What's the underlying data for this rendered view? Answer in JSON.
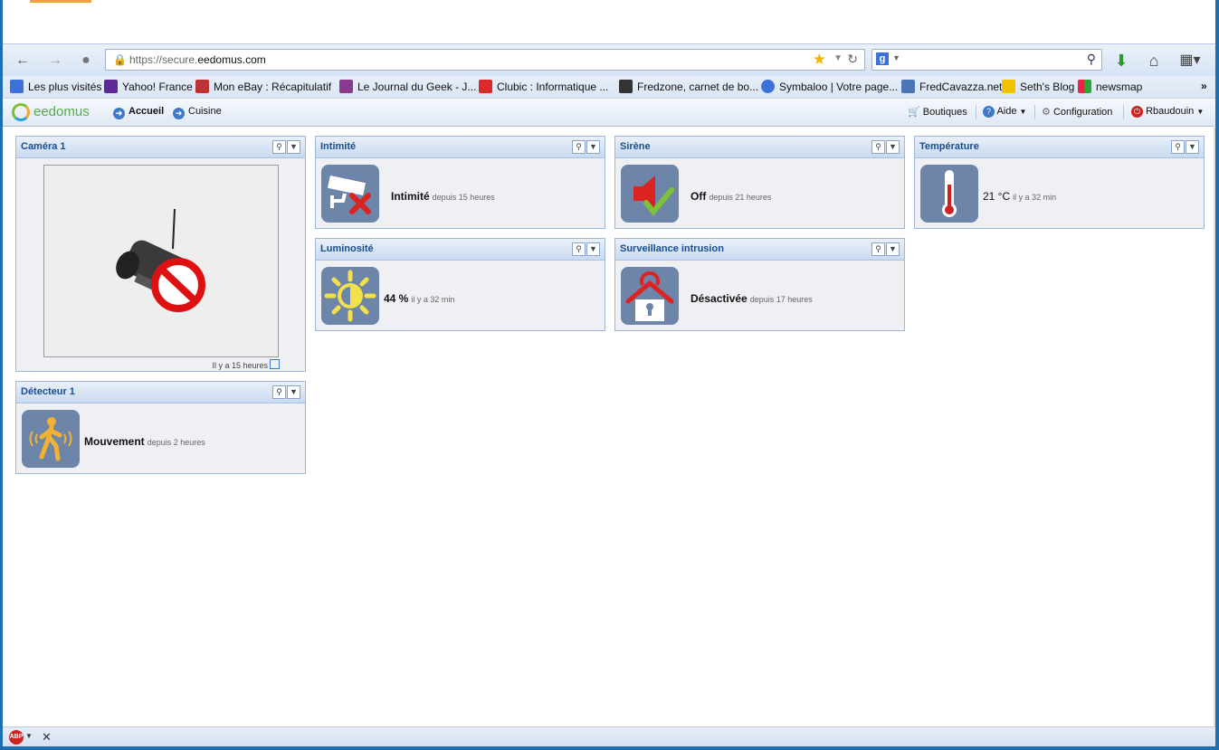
{
  "browser": {
    "url_prefix": "https://secure.",
    "url_domain": "eedomus.com",
    "bookmarks": [
      {
        "label": "Les plus visités",
        "icon": "globe-icon",
        "color": "#3b72d9"
      },
      {
        "label": "Yahoo! France",
        "icon": "yahoo-icon",
        "color": "#5f2a96"
      },
      {
        "label": "Mon eBay : Récapitulatif",
        "icon": "ebay-icon",
        "color": "#b33"
      },
      {
        "label": "Le Journal du Geek - J...",
        "icon": "geek-icon",
        "color": "#8a3a8e"
      },
      {
        "label": "Clubic : Informatique ...",
        "icon": "clubic-icon",
        "color": "#d92b2b"
      },
      {
        "label": "Fredzone, carnet de bo...",
        "icon": "fredzone-icon",
        "color": "#333"
      },
      {
        "label": "Symbaloo | Votre page...",
        "icon": "symbaloo-icon",
        "color": "#3b72d9"
      },
      {
        "label": "FredCavazza.net",
        "icon": "monitor-icon",
        "color": "#4a77b4"
      },
      {
        "label": "Seth's Blog",
        "icon": "sg-icon",
        "color": "#f2c200"
      },
      {
        "label": "newsmap",
        "icon": "newsmap-icon",
        "color": "#e24"
      }
    ],
    "more_label": "»"
  },
  "app": {
    "logo_text": "eedomus",
    "nav": [
      {
        "label": "Accueil",
        "bold": true
      },
      {
        "label": "Cuisine",
        "bold": false
      }
    ],
    "right": {
      "boutiques": "Boutiques",
      "aide": "Aide",
      "configuration": "Configuration",
      "user": "Rbaudouin"
    }
  },
  "widgets": {
    "camera": {
      "title": "Caméra 1",
      "footer": "Il y a 15 heures"
    },
    "detecteur": {
      "title": "Détecteur 1",
      "value": "Mouvement",
      "since": "depuis 2 heures"
    },
    "intimite": {
      "title": "Intimité",
      "value": "Intimité",
      "since": "depuis 15 heures"
    },
    "luminosite": {
      "title": "Luminosité",
      "value": "44 %",
      "since": "il y a 32 min"
    },
    "sirene": {
      "title": "Sirène",
      "value": "Off",
      "since": "depuis 21 heures"
    },
    "surveillance": {
      "title": "Surveillance intrusion",
      "value": "Désactivée",
      "since": "depuis 17 heures"
    },
    "temperature": {
      "title": "Température",
      "value": "21 °C",
      "since": "il y a 32 min"
    }
  },
  "colors": {
    "accent": "#1a4d8f",
    "icon_bg": "#6d85a8",
    "widget_bg": "#eef0f3"
  }
}
